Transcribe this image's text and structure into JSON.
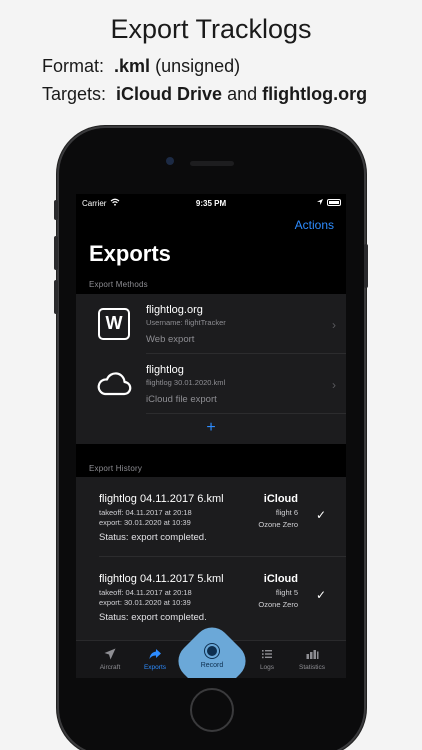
{
  "promo": {
    "headline": "Export Tracklogs",
    "format_label": "Format:",
    "format_value": ".kml",
    "format_note": "(unsigned)",
    "targets_label": "Targets:",
    "target_1": "iCloud Drive",
    "targets_and": "and",
    "target_2": "flightlog.org"
  },
  "status_bar": {
    "carrier": "Carrier",
    "time": "9:35 PM"
  },
  "nav": {
    "actions": "Actions",
    "title": "Exports"
  },
  "export_methods": {
    "header": "Export Methods",
    "items": [
      {
        "icon_letter": "W",
        "title": "flightlog.org",
        "subtitle": "Username: flightTracker",
        "desc": "Web export",
        "icon": "web-letter-icon"
      },
      {
        "title": "flightlog",
        "subtitle": "flightlog 30.01.2020.kml",
        "desc": "iCloud file export",
        "icon": "cloud-icon"
      }
    ],
    "add": "+"
  },
  "export_history": {
    "header": "Export History",
    "items": [
      {
        "title": "flightlog 04.11.2017 6.kml",
        "takeoff": "takeoff: 04.11.2017 at 20:18",
        "export": "export: 30.01.2020 at 10:39",
        "status": "Status: export completed.",
        "target": "iCloud",
        "flight": "flight 6",
        "glider": "Ozone Zero"
      },
      {
        "title": "flightlog 04.11.2017 5.kml",
        "takeoff": "takeoff: 04.11.2017 at 20:18",
        "export": "export: 30.01.2020 at 10:39",
        "status": "Status: export completed.",
        "target": "iCloud",
        "flight": "flight 5",
        "glider": "Ozone Zero"
      }
    ]
  },
  "tabs": {
    "aircraft": "Aircraft",
    "exports": "Exports",
    "record": "Record",
    "logs": "Logs",
    "statistics": "Statistics"
  },
  "colors": {
    "accent": "#2d8cff",
    "record": "#6ba8d8",
    "background": "#000000",
    "cell": "#1c1c1e"
  }
}
